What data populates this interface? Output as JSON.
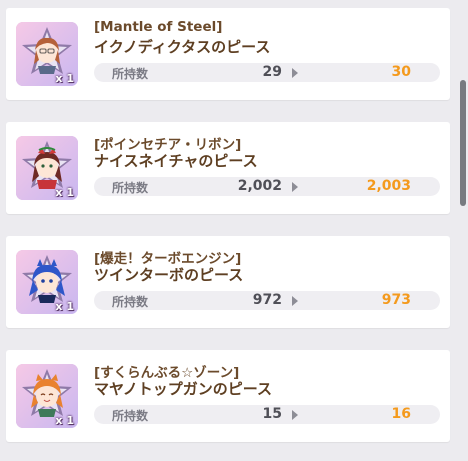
{
  "colors": {
    "background": "#ecebef",
    "card": "#ffffff",
    "title": "#6b4a2b",
    "owned_value": "#4f4f57",
    "after_value": "#f49a1d"
  },
  "items": [
    {
      "series": "[Mantle of Steel]",
      "name": "イクノディクタスのピース",
      "owned_label": "所持数",
      "owned": "29",
      "after": "30",
      "quantity": "x 1",
      "icon": "character-piece-icon"
    },
    {
      "series": "[ポインセチア・リボン]",
      "name": "ナイスネイチャのピース",
      "owned_label": "所持数",
      "owned": "2,002",
      "after": "2,003",
      "quantity": "x 1",
      "icon": "character-piece-icon"
    },
    {
      "series": "[爆走！ターボエンジン]",
      "name": "ツインターボのピース",
      "owned_label": "所持数",
      "owned": "972",
      "after": "973",
      "quantity": "x 1",
      "icon": "character-piece-icon"
    },
    {
      "series": "[すくらんぶる☆ゾーン]",
      "name": "マヤノトップガンのピース",
      "owned_label": "所持数",
      "owned": "15",
      "after": "16",
      "quantity": "x 1",
      "icon": "character-piece-icon"
    }
  ]
}
